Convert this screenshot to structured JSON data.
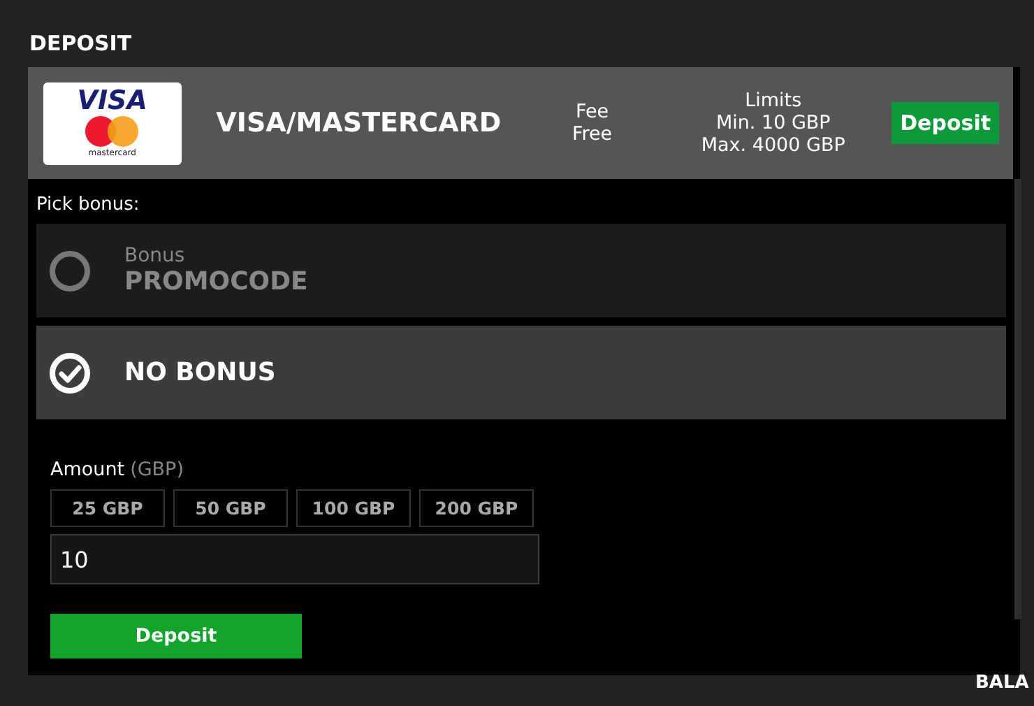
{
  "page_title": "DEPOSIT",
  "method": {
    "logo_texts": [
      "VISA",
      "mastercard"
    ],
    "name": "VISA/MASTERCARD",
    "fee_label": "Fee",
    "fee_value": "Free",
    "limits_label": "Limits",
    "limits_min": "Min. 10 GBP",
    "limits_max": "Max. 4000 GBP",
    "button": "Deposit"
  },
  "bonus_label": "Pick bonus:",
  "bonus_options": [
    {
      "caption": "Bonus",
      "title": "PROMOCODE",
      "selected": false
    },
    {
      "title": "NO BONUS",
      "selected": true
    }
  ],
  "amount": {
    "label": "Amount",
    "unit": "(GBP)",
    "presets": [
      "25 GBP",
      "50 GBP",
      "100 GBP",
      "200 GBP"
    ],
    "value": "10"
  },
  "submit": "Deposit",
  "footer_text": "BALA"
}
